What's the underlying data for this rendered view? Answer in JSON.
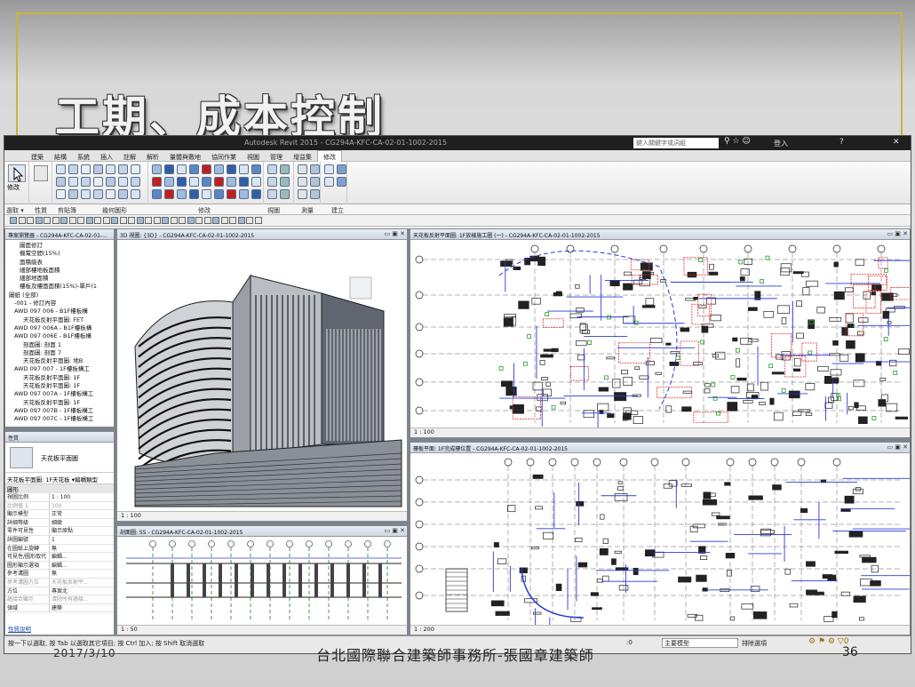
{
  "slide": {
    "title": "工期、成本控制",
    "date": "2017/3/10",
    "footer": "台北國際聯合建築師事務所-張國章建築師",
    "page_number": "36"
  },
  "app": {
    "title": "Autodesk Revit 2015 - CG294A-KFC-CA-02-01-1002-2015",
    "search_placeholder": "鍵入關鍵字或詞組",
    "user": "登入",
    "tabs": [
      "建築",
      "結構",
      "系統",
      "插入",
      "註解",
      "解析",
      "量體與敷地",
      "協同作業",
      "視圖",
      "管理",
      "增益集",
      "修改"
    ],
    "active_tab": "修改",
    "ribbon_groups": [
      "選取",
      "性質",
      "剪貼簿",
      "幾何圖形",
      "修改",
      "視圖",
      "測量",
      "建立"
    ],
    "modify_label": "修改",
    "options_bar": [
      "選取 ▾",
      "性質",
      "剪貼簿",
      "幾何圖形",
      "修改",
      "視圖",
      "測量",
      "建立"
    ]
  },
  "browser": {
    "title": "專案瀏覽器 - CG294A-KFC-CA-02-01-...",
    "items": [
      "圖面修訂",
      "機電空間(15%)",
      "面積級表",
      "細部樓地板面積",
      "細部地面積",
      "樓板及樓面面積(15%)-單戶(1",
      "圖紙 (全部)",
      "-001 - 修訂內容",
      "AWD 097 006 - B1F樓板構",
      "天花板反射平面圖: FET",
      "AWD 097 006A - B1F樓板構",
      "AWD 097 006E - B1F樓板構",
      "剖面圖: 剖面 1",
      "剖面圖: 剖面 7",
      "天花板反射平面圖: 地B",
      "AWD 097 007 - 1F樓板構工",
      "天花板反射平面圖: 1F",
      "天花板反射平面圖: 1F",
      "AWD 097 007A - 1F樓板構工",
      "天花板反射平面圖: 1F",
      "AWD 097 007B - 1F樓板構工",
      "AWD 097 007C - 1F樓板構工"
    ]
  },
  "properties": {
    "title": "性質",
    "type_name": "天花板平面圖",
    "selector": "天花板平面圖: 1F天花板 ▾",
    "edit_type": "編輯類型",
    "section": "圖形",
    "rows": [
      {
        "k": "視圖比例",
        "v": "1 : 100"
      },
      {
        "k": "比例值 1:",
        "v": "100"
      },
      {
        "k": "顯示模型",
        "v": "正常"
      },
      {
        "k": "詳細等級",
        "v": "細緻"
      },
      {
        "k": "零件可見性",
        "v": "顯示原點"
      },
      {
        "k": "詳圖編號",
        "v": "1"
      },
      {
        "k": "在圖紙上旋轉",
        "v": "無"
      },
      {
        "k": "可見性/圖形取代",
        "v": "編輯..."
      },
      {
        "k": "圖形顯示選項",
        "v": "編輯..."
      },
      {
        "k": "參考溝圖",
        "v": "無"
      },
      {
        "k": "參考溝圖方位",
        "v": "天花板反射平..."
      },
      {
        "k": "方位",
        "v": "專案北"
      },
      {
        "k": "牆接合顯示",
        "v": "清除所有牆接..."
      },
      {
        "k": "領域",
        "v": "建築"
      }
    ],
    "help_link": "性質說明"
  },
  "views": {
    "v3d": {
      "title": "3D 視圖: {3D} - CG294A-KFC-CA-02-01-1002-2015",
      "scale": "1 : 100"
    },
    "ceiling": {
      "title": "天花板反射平面圖: 1F放樣施工圖 (一) - CG294A-KFC-CA-02-01-1002-2015",
      "scale": "1 : 100"
    },
    "section": {
      "title": "剖面圖: S5 - CG294A-KFC-CA-02-01-1002-2015",
      "scale": "1 : 50"
    },
    "floor": {
      "title": "樓板平面: 1F完成樓位置 - CG294A-KFC-CA-02-01-1002-2015",
      "scale": "1 : 200"
    }
  },
  "status": {
    "hint": "按一下以選取, 按 Tab 以選取其它項目; 按 Ctrl 加入; 按 Shift 取消選取",
    "zero": ":0",
    "model": "主要模型",
    "exclude": "排除選項"
  },
  "colors": {
    "accent_gold": "#c9b43a",
    "grid_red": "#e03030",
    "dim_blue": "#2a3cd6",
    "tag_green": "#2a9a2a"
  }
}
